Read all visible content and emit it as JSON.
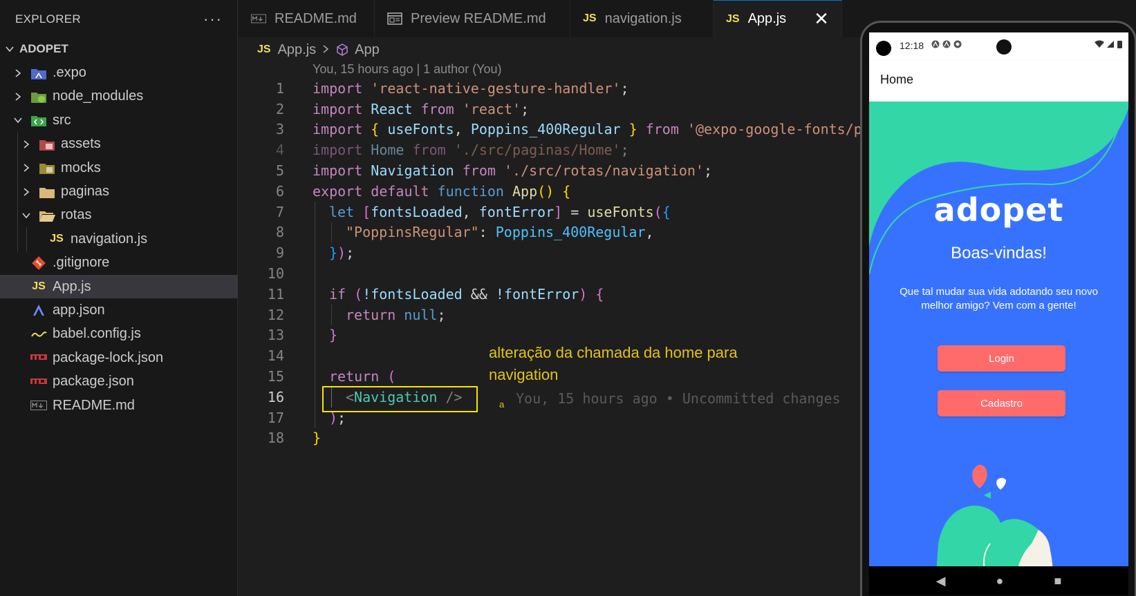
{
  "sidebar": {
    "title": "EXPLORER",
    "more": "···",
    "root": "ADOPET",
    "items": [
      {
        "label": ".expo"
      },
      {
        "label": "node_modules"
      },
      {
        "label": "src"
      },
      {
        "label": "assets"
      },
      {
        "label": "mocks"
      },
      {
        "label": "paginas"
      },
      {
        "label": "rotas"
      },
      {
        "label": "navigation.js"
      },
      {
        "label": ".gitignore"
      },
      {
        "label": "App.js"
      },
      {
        "label": "app.json"
      },
      {
        "label": "babel.config.js"
      },
      {
        "label": "package-lock.json"
      },
      {
        "label": "package.json"
      },
      {
        "label": "README.md"
      }
    ]
  },
  "tabs": [
    {
      "label": "README.md"
    },
    {
      "label": "Preview README.md"
    },
    {
      "label": "navigation.js"
    },
    {
      "label": "App.js"
    }
  ],
  "js_badge": "JS",
  "close_glyph": "✕",
  "breadcrumb": {
    "file": "App.js",
    "symbol": "App"
  },
  "blame_header": "You, 15 hours ago | 1 author (You)",
  "line_numbers": [
    "1",
    "2",
    "3",
    "4",
    "5",
    "6",
    "7",
    "8",
    "9",
    "10",
    "11",
    "12",
    "13",
    "14",
    "15",
    "16",
    "17",
    "18"
  ],
  "code": {
    "l1": {
      "a": "import",
      "b": "'react-native-gesture-handler'",
      "c": ";"
    },
    "l2": {
      "a": "import",
      "b": "React",
      "c": "from",
      "d": "'react'",
      "e": ";"
    },
    "l3": {
      "a": "import",
      "b": "{",
      "c": "useFonts",
      "d": ",",
      "e": "Poppins_400Regular",
      "f": "}",
      "g": "from",
      "h": "'@expo-google-fonts/p"
    },
    "l4": {
      "a": "import",
      "b": "Home",
      "c": "from",
      "d": "'./src/paginas/Home'",
      "e": ";"
    },
    "l5": {
      "a": "import",
      "b": "Navigation",
      "c": "from",
      "d": "'./src/rotas/navigation'",
      "e": ";"
    },
    "l6": {
      "a": "export",
      "b": "default",
      "c": "function",
      "d": "App",
      "e": "()",
      "f": "{"
    },
    "l7": {
      "a": "let",
      "b": "[",
      "c": "fontsLoaded",
      "d": ",",
      "e": "fontError",
      "f": "]",
      "g": "=",
      "h": "useFonts",
      "i": "(",
      "j": "{"
    },
    "l8": {
      "a": "\"PoppinsRegular\"",
      "b": ":",
      "c": "Poppins_400Regular",
      "d": ","
    },
    "l9": {
      "a": "}",
      "b": ")",
      "c": ";"
    },
    "l11": {
      "a": "if",
      "b": "(",
      "c": "!fontsLoaded",
      "d": "&&",
      "e": "!fontError",
      "f": ")",
      "g": "{"
    },
    "l12": {
      "a": "return",
      "b": "null",
      "c": ";"
    },
    "l13": {
      "a": "}"
    },
    "l15": {
      "a": "return",
      "b": "("
    },
    "l16": {
      "a": "<",
      "b": "Navigation",
      "c": "/>"
    },
    "l17": {
      "a": ")",
      "b": ";"
    },
    "l18": {
      "a": "}"
    }
  },
  "annotation": "alteração da chamada da home para navigation",
  "blame_inline": "You, 15 hours ago • Uncommitted changes",
  "blame_marker": "a",
  "phone": {
    "time": "12:18",
    "appbar_title": "Home",
    "logo": "adopet",
    "welcome": "Boas-vindas!",
    "tagline": "Que tal mudar sua vida adotando seu novo melhor amigo? Vem com a gente!",
    "login": "Login",
    "signup": "Cadastro",
    "nav_back": "◀",
    "nav_home": "●",
    "nav_recents": "■"
  },
  "colors": {
    "phone_bg": "#3772ff",
    "phone_wave": "#33d6a6",
    "button": "#ff6b6b",
    "highlight_box": "#f5e600"
  }
}
